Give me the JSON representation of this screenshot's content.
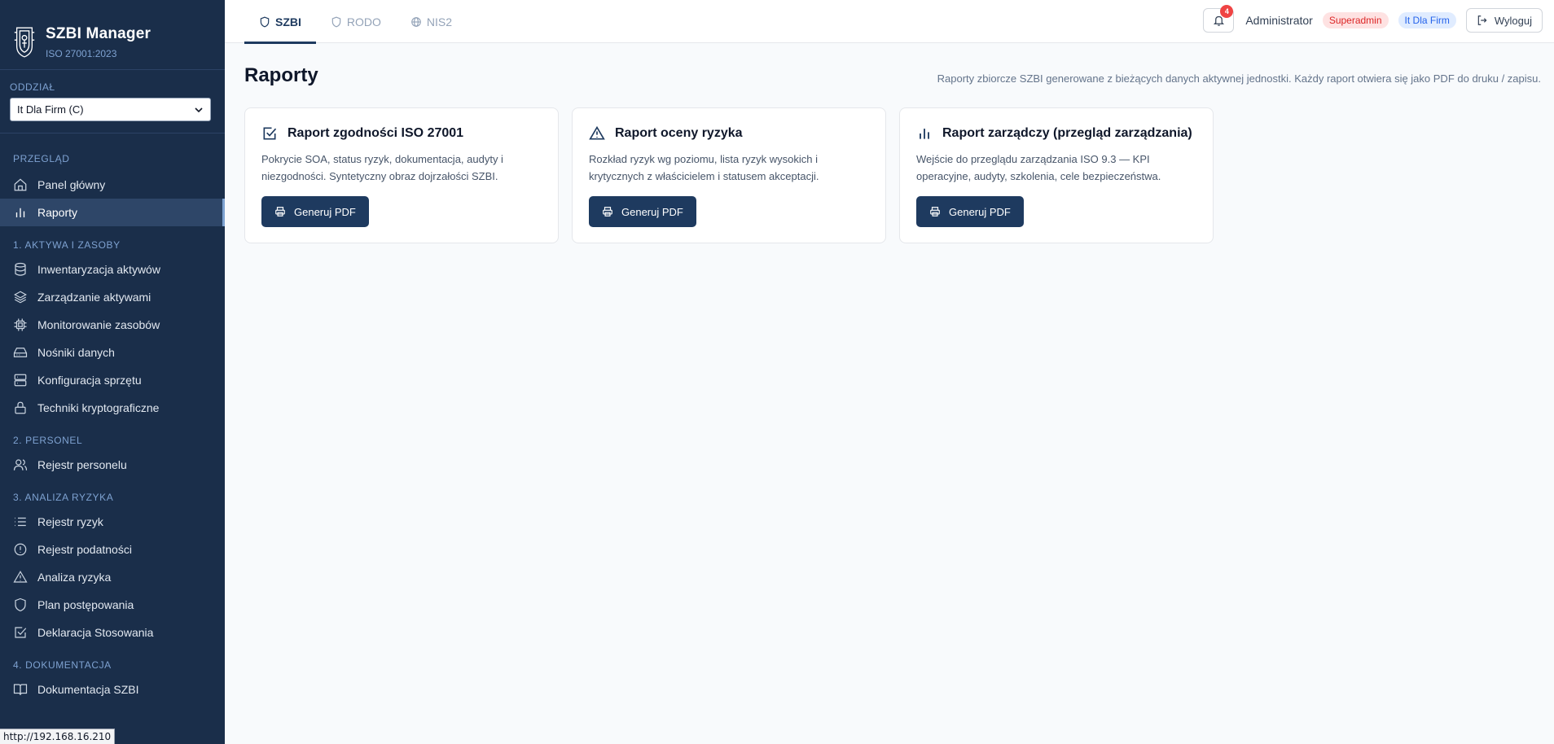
{
  "brand": {
    "title": "SZBI Manager",
    "subtitle": "ISO 27001:2023",
    "logo_icon": "crest-logo-icon"
  },
  "branch": {
    "label": "ODDZIAŁ",
    "selected": "It Dla Firm (C)"
  },
  "sidebar": {
    "sections": [
      {
        "title": "PRZEGLĄD",
        "items": [
          {
            "label": "Panel główny",
            "icon": "home-icon"
          },
          {
            "label": "Raporty",
            "icon": "bar-chart-icon",
            "active": true
          }
        ]
      },
      {
        "title": "1. AKTYWA I ZASOBY",
        "items": [
          {
            "label": "Inwentaryzacja aktywów",
            "icon": "database-icon"
          },
          {
            "label": "Zarządzanie aktywami",
            "icon": "layers-icon"
          },
          {
            "label": "Monitorowanie zasobów",
            "icon": "cpu-icon"
          },
          {
            "label": "Nośniki danych",
            "icon": "hard-drive-icon"
          },
          {
            "label": "Konfiguracja sprzętu",
            "icon": "server-icon"
          },
          {
            "label": "Techniki kryptograficzne",
            "icon": "lock-icon"
          }
        ]
      },
      {
        "title": "2. PERSONEL",
        "items": [
          {
            "label": "Rejestr personelu",
            "icon": "users-icon"
          }
        ]
      },
      {
        "title": "3. ANALIZA RYZYKA",
        "items": [
          {
            "label": "Rejestr ryzyk",
            "icon": "list-icon"
          },
          {
            "label": "Rejestr podatności",
            "icon": "alert-circle-icon"
          },
          {
            "label": "Analiza ryzyka",
            "icon": "alert-triangle-icon"
          },
          {
            "label": "Plan postępowania",
            "icon": "shield-icon"
          },
          {
            "label": "Deklaracja Stosowania",
            "icon": "check-square-icon"
          }
        ]
      },
      {
        "title": "4. DOKUMENTACJA",
        "items": [
          {
            "label": "Dokumentacja SZBI",
            "icon": "book-open-icon"
          }
        ]
      }
    ]
  },
  "status_url": "http://192.168.16.210",
  "tabs": [
    {
      "label": "SZBI",
      "icon": "shield-icon",
      "active": true
    },
    {
      "label": "RODO",
      "icon": "shield-icon",
      "active": false
    },
    {
      "label": "NIS2",
      "icon": "globe-icon",
      "active": false
    }
  ],
  "header": {
    "notifications": "4",
    "user": "Administrator",
    "role_badge": "Superadmin",
    "org_badge": "It Dla Firm",
    "logout_label": "Wyloguj",
    "colors": {
      "primary": "#1e3a5f",
      "sidebar": "#1a2e4a",
      "danger": "#ef4444"
    }
  },
  "page": {
    "title": "Raporty",
    "description": "Raporty zbiorcze SZBI generowane z bieżących danych aktywnej jednostki. Każdy raport otwiera się jako PDF do druku / zapisu."
  },
  "reports": [
    {
      "title": "Raport zgodności ISO 27001",
      "icon": "check-square-icon",
      "description": "Pokrycie SOA, status ryzyk, dokumentacja, audyty i niezgodności. Syntetyczny obraz dojrzałości SZBI.",
      "button": "Generuj PDF"
    },
    {
      "title": "Raport oceny ryzyka",
      "icon": "alert-triangle-icon",
      "description": "Rozkład ryzyk wg poziomu, lista ryzyk wysokich i krytycznych z właścicielem i statusem akceptacji.",
      "button": "Generuj PDF"
    },
    {
      "title": "Raport zarządczy (przegląd zarządzania)",
      "icon": "bar-chart-icon",
      "description": "Wejście do przeglądu zarządzania ISO 9.3 — KPI operacyjne, audyty, szkolenia, cele bezpieczeństwa.",
      "button": "Generuj PDF"
    }
  ]
}
